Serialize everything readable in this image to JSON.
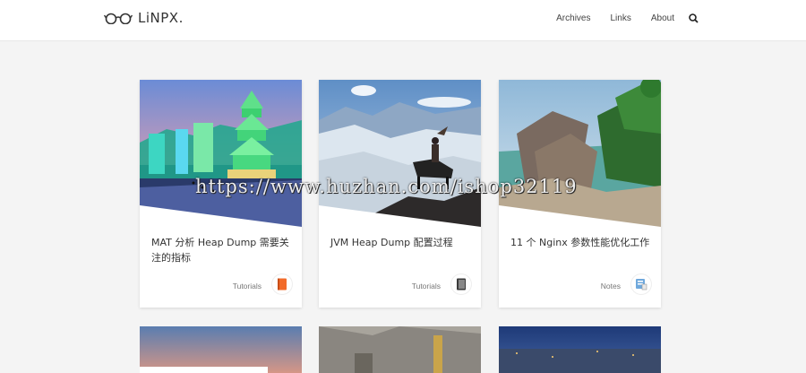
{
  "header": {
    "logo_text": "LiNPX.",
    "nav": [
      {
        "label": "Archives"
      },
      {
        "label": "Links"
      },
      {
        "label": "About"
      }
    ]
  },
  "posts": [
    {
      "title": "MAT 分析 Heap Dump 需要关注的指标",
      "category": "Tutorials",
      "category_icon": "book-orange-icon"
    },
    {
      "title": "JVM Heap Dump 配置过程",
      "category": "Tutorials",
      "category_icon": "book-dark-icon"
    },
    {
      "title": "11 个 Nginx 参数性能优化工作",
      "category": "Notes",
      "category_icon": "notes-icon"
    }
  ],
  "watermark": "https://www.huzhan.com/ishop32119",
  "colors": {
    "background": "#f4f4f4",
    "header_bg": "#ffffff",
    "card_bg": "#ffffff",
    "text": "#333333"
  }
}
